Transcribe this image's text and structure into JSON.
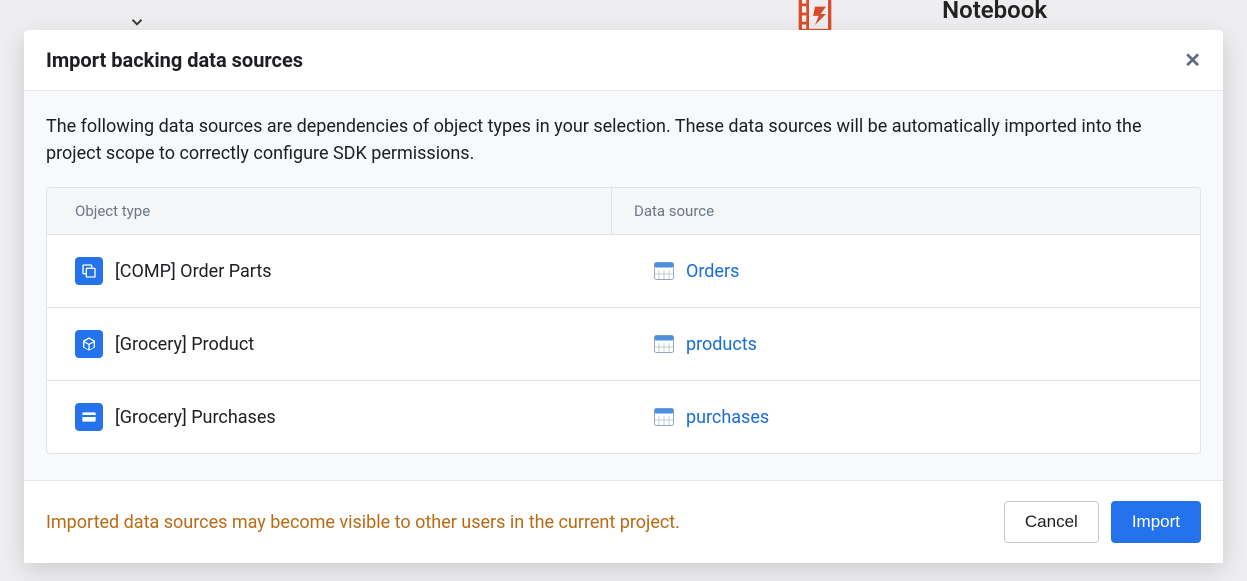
{
  "background": {
    "notebook_label": "Notebook"
  },
  "dialog": {
    "title": "Import backing data sources",
    "description": "The following data sources are dependencies of object types in your selection. These data sources will be automatically imported into the project scope to correctly configure SDK permissions.",
    "table": {
      "columns": {
        "object_type": "Object type",
        "data_source": "Data source"
      },
      "rows": [
        {
          "icon": "layers",
          "object_label": "[COMP] Order Parts",
          "source_label": "Orders"
        },
        {
          "icon": "cube",
          "object_label": "[Grocery] Product",
          "source_label": "products"
        },
        {
          "icon": "card",
          "object_label": "[Grocery] Purchases",
          "source_label": "purchases"
        }
      ]
    },
    "warning": "Imported data sources may become visible to other users in the current project.",
    "buttons": {
      "cancel": "Cancel",
      "import": "Import"
    }
  }
}
